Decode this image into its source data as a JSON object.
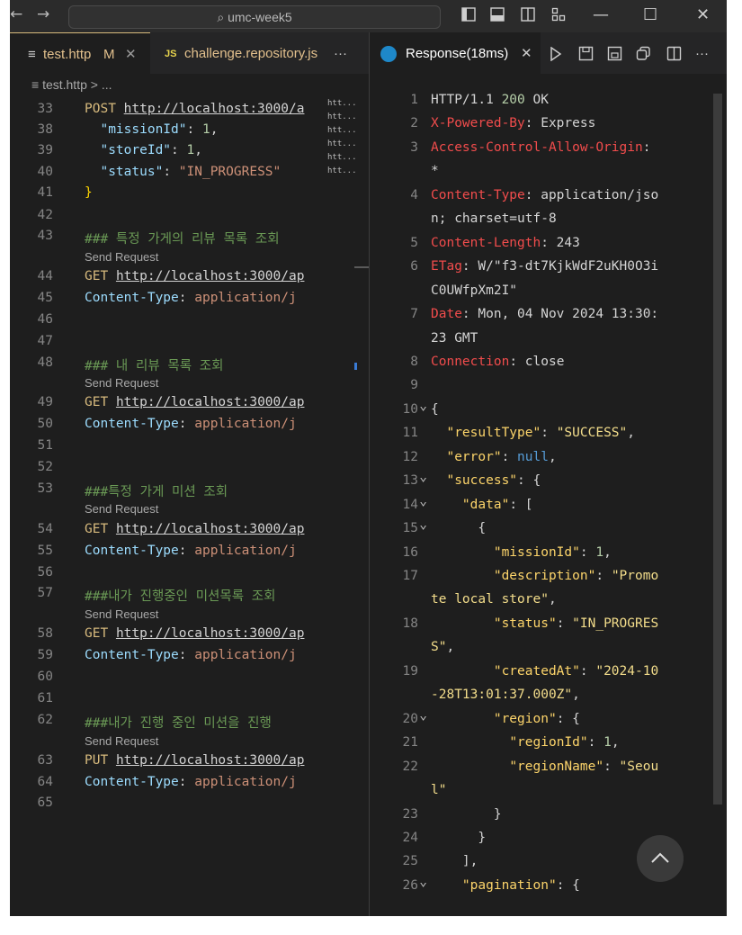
{
  "titlebar": {
    "back": "←",
    "forward": "→",
    "search_text": "umc-week5",
    "minimize": "—",
    "maximize": "☐",
    "close": "✕"
  },
  "tabs_left": [
    {
      "icon": "≡",
      "label": "test.http",
      "suffix": "M",
      "close": "✕"
    },
    {
      "icon": "JS",
      "label": "challenge.repository.js"
    }
  ],
  "tabs_left_more": "···",
  "tabs_right": {
    "label": "Response(18ms)",
    "close": "✕"
  },
  "right_more": "···",
  "breadcrumb": {
    "icon": "≡",
    "text": "test.http > ..."
  },
  "minimap": [
    "htt...",
    "htt...",
    "htt...",
    "htt...",
    "htt...",
    "htt..."
  ],
  "editor": {
    "lines": [
      {
        "n": "33",
        "type": "req",
        "method": "POST",
        "url": "http://localhost:3000/a"
      },
      {
        "n": "38",
        "type": "json",
        "key": "\"missionId\"",
        "val": "1",
        "vtype": "num",
        "comma": ","
      },
      {
        "n": "39",
        "type": "json",
        "key": "\"storeId\"",
        "val": "1",
        "vtype": "num",
        "comma": ","
      },
      {
        "n": "40",
        "type": "json",
        "key": "\"status\"",
        "val": "\"IN_PROGRESS\"",
        "vtype": "str",
        "comma": ""
      },
      {
        "n": "41",
        "type": "brace",
        "text": "}"
      },
      {
        "n": "42",
        "type": "blank"
      },
      {
        "n": "43",
        "type": "comment",
        "text": "### 특정 가게의 리뷰 목록 조회"
      },
      {
        "type": "lens",
        "text": "Send Request"
      },
      {
        "n": "44",
        "type": "req",
        "method": "GET",
        "url": "http://localhost:3000/ap"
      },
      {
        "n": "45",
        "type": "hdr",
        "key": "Content-Type",
        "val": "application/j"
      },
      {
        "n": "46",
        "type": "blank"
      },
      {
        "n": "47",
        "type": "blank"
      },
      {
        "n": "48",
        "type": "comment",
        "text": "### 내 리뷰 목록 조회"
      },
      {
        "type": "lens",
        "text": "Send Request"
      },
      {
        "n": "49",
        "type": "req",
        "method": "GET",
        "url": "http://localhost:3000/ap"
      },
      {
        "n": "50",
        "type": "hdr",
        "key": "Content-Type",
        "val": "application/j"
      },
      {
        "n": "51",
        "type": "blank"
      },
      {
        "n": "52",
        "type": "blank"
      },
      {
        "n": "53",
        "type": "comment",
        "text": "###특정 가게 미션 조회"
      },
      {
        "type": "lens",
        "text": "Send Request"
      },
      {
        "n": "54",
        "type": "req",
        "method": "GET",
        "url": "http://localhost:3000/ap"
      },
      {
        "n": "55",
        "type": "hdr",
        "key": "Content-Type",
        "val": "application/j"
      },
      {
        "n": "56",
        "type": "blank"
      },
      {
        "n": "57",
        "type": "comment",
        "text": "###내가 진행중인 미션목록 조회"
      },
      {
        "type": "lens",
        "text": "Send Request"
      },
      {
        "n": "58",
        "type": "req",
        "method": "GET",
        "url": "http://localhost:3000/ap"
      },
      {
        "n": "59",
        "type": "hdr",
        "key": "Content-Type",
        "val": "application/j"
      },
      {
        "n": "60",
        "type": "blank"
      },
      {
        "n": "61",
        "type": "blank"
      },
      {
        "n": "62",
        "type": "comment",
        "text": "###내가 진행 중인 미션을 진행"
      },
      {
        "type": "lens",
        "text": "Send Request"
      },
      {
        "n": "63",
        "type": "req",
        "method": "PUT",
        "url": "http://localhost:3000/ap"
      },
      {
        "n": "64",
        "type": "hdr",
        "key": "Content-Type",
        "val": "application/j"
      },
      {
        "n": "65",
        "type": "blank"
      }
    ]
  },
  "response": {
    "lines": [
      {
        "n": "1",
        "parts": [
          [
            "r-val",
            "HTTP/1.1 "
          ],
          [
            "j-num",
            "200"
          ],
          [
            "r-val",
            " OK"
          ]
        ]
      },
      {
        "n": "2",
        "parts": [
          [
            "r-key",
            "X-Powered-By"
          ],
          [
            "r-val",
            ": Express"
          ]
        ]
      },
      {
        "n": "3",
        "parts": [
          [
            "r-key",
            "Access-Control-Allow-Origin"
          ],
          [
            "r-val",
            ":"
          ]
        ]
      },
      {
        "n": "",
        "parts": [
          [
            "r-val",
            "*"
          ]
        ]
      },
      {
        "n": "4",
        "parts": [
          [
            "r-key",
            "Content-Type"
          ],
          [
            "r-val",
            ": application/jso"
          ]
        ]
      },
      {
        "n": "",
        "parts": [
          [
            "r-val",
            "n; charset=utf-8"
          ]
        ]
      },
      {
        "n": "5",
        "parts": [
          [
            "r-key",
            "Content-Length"
          ],
          [
            "r-val",
            ": 243"
          ]
        ]
      },
      {
        "n": "6",
        "parts": [
          [
            "r-key",
            "ETag"
          ],
          [
            "r-val",
            ": W/\"f3-dt7KjkWdF2uKH0O3i"
          ]
        ]
      },
      {
        "n": "",
        "parts": [
          [
            "r-val",
            "C0UWfpXm2I\""
          ]
        ]
      },
      {
        "n": "7",
        "parts": [
          [
            "r-key",
            "Date"
          ],
          [
            "r-val",
            ": Mon, 04 Nov 2024 13:30:"
          ]
        ]
      },
      {
        "n": "",
        "parts": [
          [
            "r-val",
            "23 GMT"
          ]
        ]
      },
      {
        "n": "8",
        "parts": [
          [
            "r-key",
            "Connection"
          ],
          [
            "r-val",
            ": close"
          ]
        ]
      },
      {
        "n": "9",
        "parts": []
      },
      {
        "n": "10",
        "fold": true,
        "parts": [
          [
            "j-brace",
            "{"
          ]
        ]
      },
      {
        "n": "11",
        "parts": [
          [
            "j-brace",
            "  "
          ],
          [
            "j-key",
            "\"resultType\""
          ],
          [
            "j-brace",
            ": "
          ],
          [
            "j-str",
            "\"SUCCESS\""
          ],
          [
            "j-brace",
            ","
          ]
        ]
      },
      {
        "n": "12",
        "parts": [
          [
            "j-brace",
            "  "
          ],
          [
            "j-key",
            "\"error\""
          ],
          [
            "j-brace",
            ": "
          ],
          [
            "j-null",
            "null"
          ],
          [
            "j-brace",
            ","
          ]
        ]
      },
      {
        "n": "13",
        "fold": true,
        "parts": [
          [
            "j-brace",
            "  "
          ],
          [
            "j-key",
            "\"success\""
          ],
          [
            "j-brace",
            ": {"
          ]
        ]
      },
      {
        "n": "14",
        "fold": true,
        "parts": [
          [
            "j-brace",
            "    "
          ],
          [
            "j-key",
            "\"data\""
          ],
          [
            "j-brace",
            ": ["
          ]
        ]
      },
      {
        "n": "15",
        "fold": true,
        "parts": [
          [
            "j-brace",
            "      {"
          ]
        ]
      },
      {
        "n": "16",
        "parts": [
          [
            "j-brace",
            "        "
          ],
          [
            "j-key",
            "\"missionId\""
          ],
          [
            "j-brace",
            ": "
          ],
          [
            "j-num",
            "1"
          ],
          [
            "j-brace",
            ","
          ]
        ]
      },
      {
        "n": "17",
        "parts": [
          [
            "j-brace",
            "        "
          ],
          [
            "j-key",
            "\"description\""
          ],
          [
            "j-brace",
            ": "
          ],
          [
            "j-str",
            "\"Promo"
          ]
        ]
      },
      {
        "n": "",
        "parts": [
          [
            "j-str",
            "te local store\""
          ],
          [
            "j-brace",
            ","
          ]
        ]
      },
      {
        "n": "18",
        "parts": [
          [
            "j-brace",
            "        "
          ],
          [
            "j-key",
            "\"status\""
          ],
          [
            "j-brace",
            ": "
          ],
          [
            "j-str",
            "\"IN_PROGRES"
          ]
        ]
      },
      {
        "n": "",
        "parts": [
          [
            "j-str",
            "S\""
          ],
          [
            "j-brace",
            ","
          ]
        ]
      },
      {
        "n": "19",
        "parts": [
          [
            "j-brace",
            "        "
          ],
          [
            "j-key",
            "\"createdAt\""
          ],
          [
            "j-brace",
            ": "
          ],
          [
            "j-str",
            "\"2024-10"
          ]
        ]
      },
      {
        "n": "",
        "parts": [
          [
            "j-str",
            "-28T13:01:37.000Z\""
          ],
          [
            "j-brace",
            ","
          ]
        ]
      },
      {
        "n": "20",
        "fold": true,
        "parts": [
          [
            "j-brace",
            "        "
          ],
          [
            "j-key",
            "\"region\""
          ],
          [
            "j-brace",
            ": {"
          ]
        ]
      },
      {
        "n": "21",
        "parts": [
          [
            "j-brace",
            "          "
          ],
          [
            "j-key",
            "\"regionId\""
          ],
          [
            "j-brace",
            ": "
          ],
          [
            "j-num",
            "1"
          ],
          [
            "j-brace",
            ","
          ]
        ]
      },
      {
        "n": "22",
        "parts": [
          [
            "j-brace",
            "          "
          ],
          [
            "j-key",
            "\"regionName\""
          ],
          [
            "j-brace",
            ": "
          ],
          [
            "j-str",
            "\"Seou"
          ]
        ]
      },
      {
        "n": "",
        "parts": [
          [
            "j-str",
            "l\""
          ]
        ]
      },
      {
        "n": "23",
        "parts": [
          [
            "j-brace",
            "        }"
          ]
        ]
      },
      {
        "n": "24",
        "parts": [
          [
            "j-brace",
            "      }"
          ]
        ]
      },
      {
        "n": "25",
        "parts": [
          [
            "j-brace",
            "    ],"
          ]
        ]
      },
      {
        "n": "26",
        "fold": true,
        "parts": [
          [
            "j-brace",
            "    "
          ],
          [
            "j-key",
            "\"pagination\""
          ],
          [
            "j-brace",
            ": {"
          ]
        ]
      }
    ]
  }
}
